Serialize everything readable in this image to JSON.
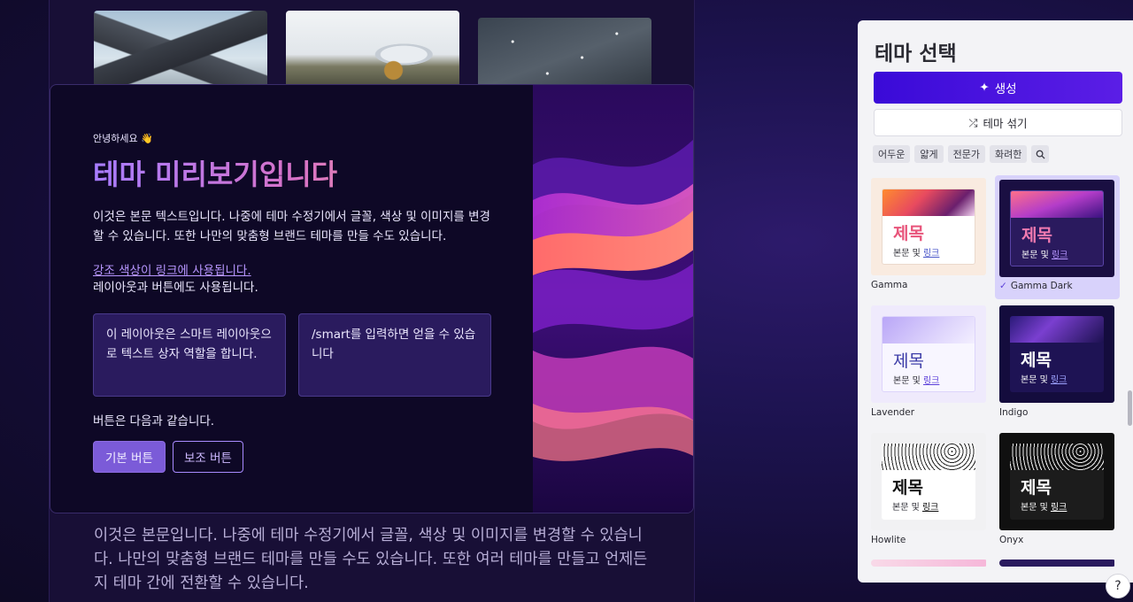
{
  "canvas": {
    "bottom_text": "이것은 본문입니다. 나중에 테마 수정기에서 글꼴, 색상 및 이미지를 변경할 수 있습니다. 나만의 맞춤형 브랜드 테마를 만들 수도 있습니다. 또한 여러 테마를 만들고 언제든지 테마 간에 전환할 수 있습니다."
  },
  "preview": {
    "greeting": "안녕하세요 👋",
    "title": "테마 미리보기입니다",
    "body": "이것은 본문 텍스트입니다. 나중에 테마 수정기에서 글꼴, 색상 및 이미지를 변경할 수 있습니다. 또한 나만의 맞춤형 브랜드 테마를 만들 수도 있습니다.",
    "accent_link": "강조 색상이 링크에 사용됩니다.",
    "body2": "레이아웃과 버튼에도 사용됩니다.",
    "box1": "이 레이아웃은 스마트 레이아웃으로 텍스트 상자 역할을 합니다.",
    "box2": "/smart를 입력하면 얻을 수 있습니다",
    "buttons_caption": "버튼은 다음과 같습니다.",
    "primary_button": "기본 버튼",
    "secondary_button": "보조 버튼"
  },
  "panel": {
    "title": "테마 선택",
    "generate_button": "생성",
    "shuffle_button": "테마 섞기",
    "filters": [
      "어두운",
      "얇게",
      "전문가",
      "화려한"
    ],
    "selected_theme": "Gamma Dark",
    "themes": [
      {
        "name": "Gamma",
        "heading": "제목",
        "body": "본문 및",
        "link": "링크",
        "selected": false
      },
      {
        "name": "Gamma Dark",
        "heading": "제목",
        "body": "본문 및",
        "link": "링크",
        "selected": true
      },
      {
        "name": "Lavender",
        "heading": "제목",
        "body": "본문 및",
        "link": "링크",
        "selected": false
      },
      {
        "name": "Indigo",
        "heading": "제목",
        "body": "본문 및",
        "link": "링크",
        "selected": false
      },
      {
        "name": "Howlite",
        "heading": "제목",
        "body": "본문 및",
        "link": "링크",
        "selected": false
      },
      {
        "name": "Onyx",
        "heading": "제목",
        "body": "본문 및",
        "link": "링크",
        "selected": false
      }
    ]
  },
  "help_label": "?",
  "colors": {
    "accent": "#5b1ee6",
    "preview_bg": "#0e0826",
    "link": "#b796ff",
    "selected_tile": "#d8d2fb"
  }
}
